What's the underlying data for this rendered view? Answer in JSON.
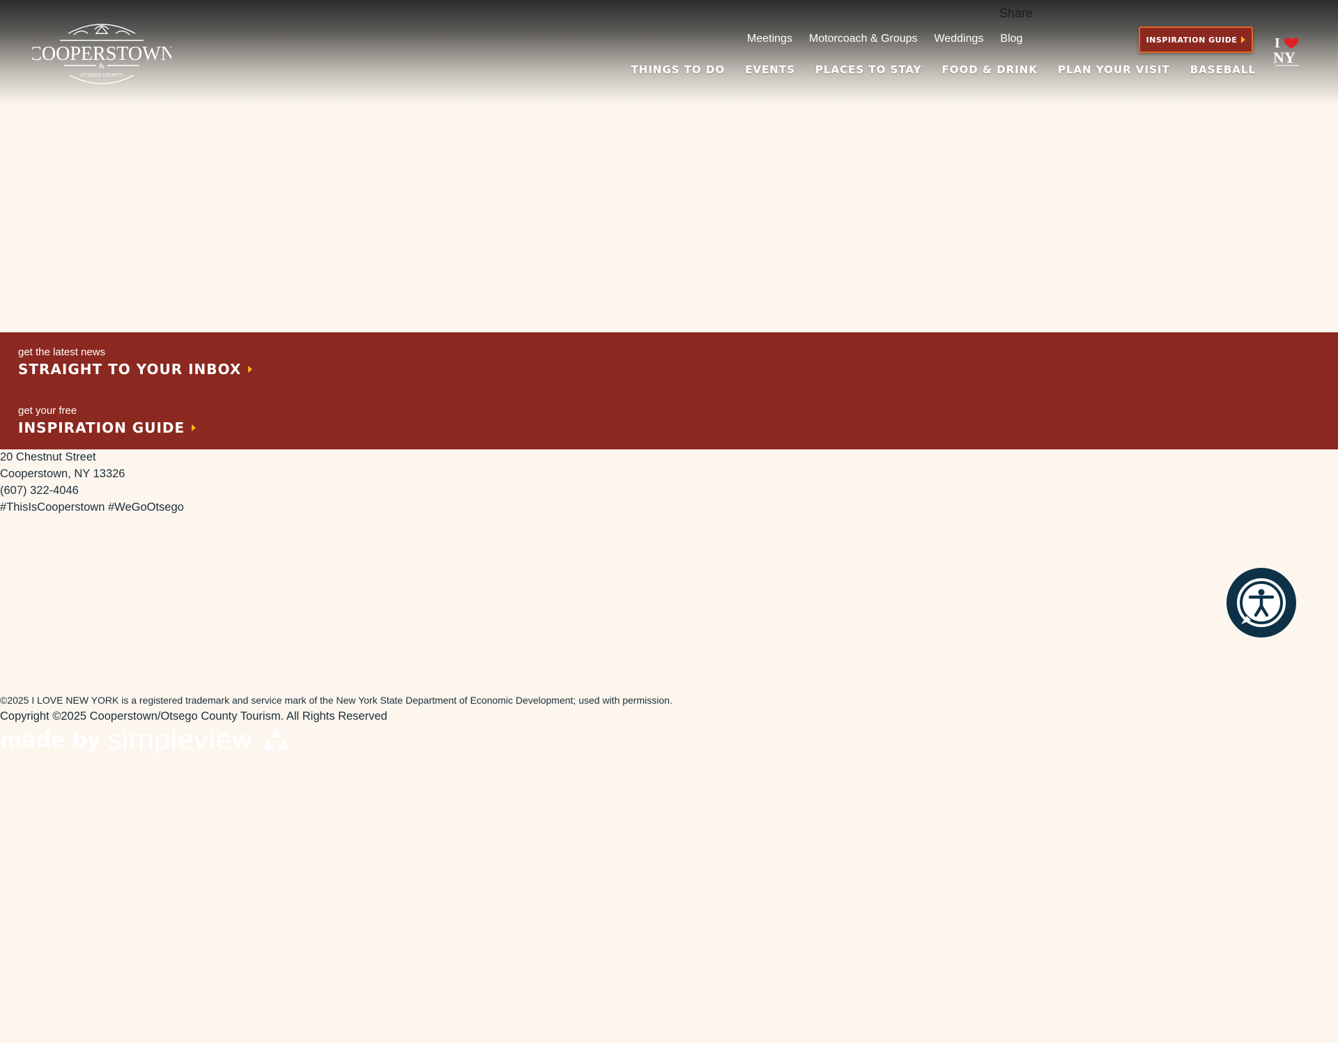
{
  "header": {
    "logo_text": "COOPERSTOWN",
    "logo_subtext": "OTSEGO COUNTY",
    "share_label": "Share",
    "utility_nav": [
      "Meetings",
      "Motorcoach & Groups",
      "Weddings",
      "Blog"
    ],
    "guide_button": "INSPIRATION GUIDE",
    "ny_logo_text": "I NY",
    "main_nav": [
      "THINGS TO DO",
      "EVENTS",
      "PLACES TO STAY",
      "FOOD & DRINK",
      "PLAN YOUR VISIT",
      "BASEBALL"
    ]
  },
  "cta": {
    "newsletter_small": "get the latest news",
    "newsletter_big": "STRAIGHT TO YOUR INBOX",
    "guide_small": "get your free",
    "guide_big": "INSPIRATION GUIDE"
  },
  "contact": {
    "street": "20 Chestnut Street",
    "city": "Cooperstown, NY 13326",
    "phone": "(607) 322-4046",
    "hashtags": "#ThisIsCooperstown #WeGoOtsego"
  },
  "footer": {
    "legal": "©2025 I LOVE NEW YORK is a registered trademark and service mark of the New York State Department of Economic Development; used with permission.",
    "copyright": "Copyright ©2025 Cooperstown/Otsego County Tourism. All Rights Reserved",
    "madeby_prefix": "made by",
    "madeby_brand": "simpleview"
  },
  "colors": {
    "background": "#fcf6ee",
    "brand_red": "#8b2820",
    "accent_yellow": "#f5b71c",
    "accessibility_navy": "#0d3248"
  },
  "icons": [
    "accessibility-icon",
    "caret-right-icon"
  ]
}
